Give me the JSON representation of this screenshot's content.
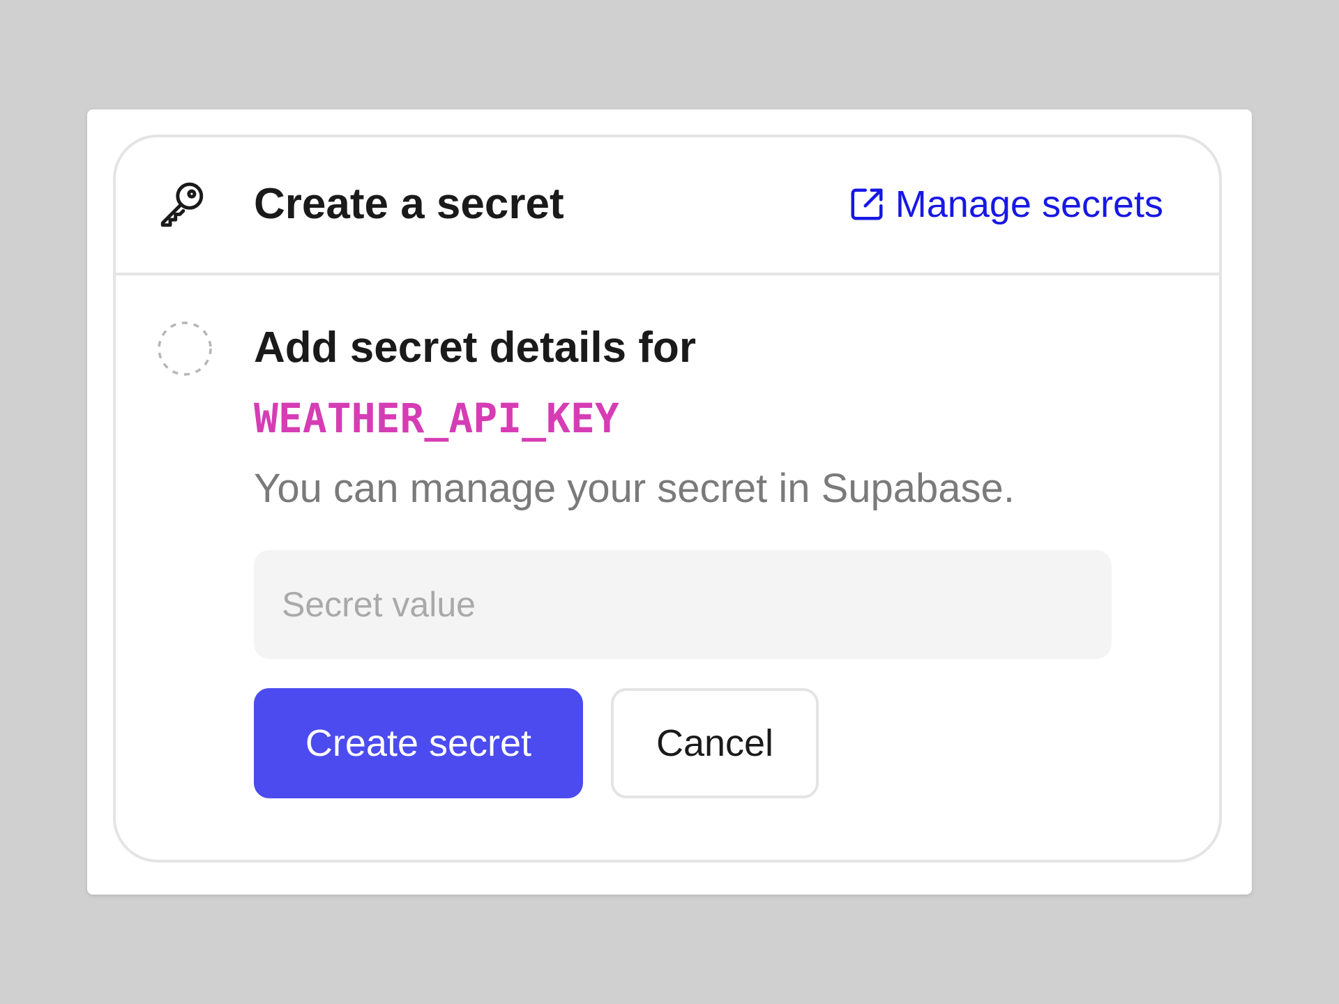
{
  "header": {
    "title": "Create a secret",
    "icon": "key-icon",
    "manage_link": {
      "label": "Manage secrets",
      "icon": "external-link-icon",
      "color": "#1717e6"
    }
  },
  "step": {
    "status_icon": "dashed-circle-icon",
    "title": "Add secret details for",
    "secret_name": "WEATHER_API_KEY",
    "secret_name_color": "#d63cb4",
    "description": "You can manage your secret in Supabase.",
    "input": {
      "value": "",
      "placeholder": "Secret value"
    },
    "primary_button": {
      "label": "Create secret",
      "color": "#4b4bef"
    },
    "secondary_button": {
      "label": "Cancel"
    }
  }
}
